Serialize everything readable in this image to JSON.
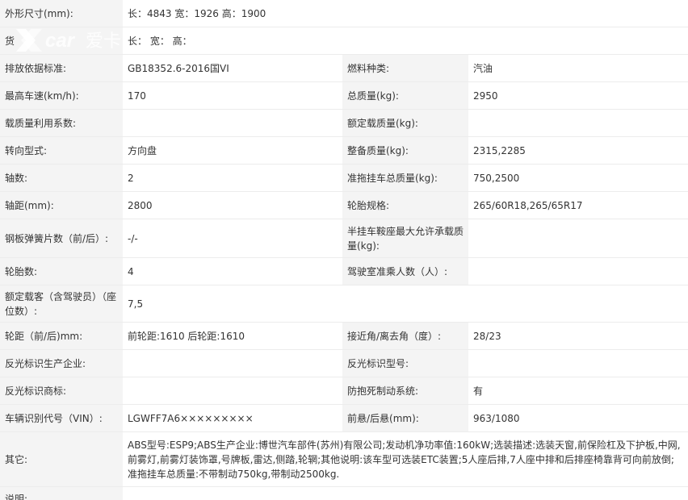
{
  "rows": [
    {
      "l1": "外形尺寸(mm):",
      "v1": "长：4843 宽：1926 高：1900",
      "l2": "",
      "v2": ""
    },
    {
      "l1": "货",
      "v1": "长：   宽：   高：",
      "l2": "",
      "v2": ""
    },
    {
      "l1": "排放依据标准:",
      "v1": "GB18352.6-2016国VI",
      "l2": "燃料种类:",
      "v2": "汽油"
    },
    {
      "l1": "最高车速(km/h):",
      "v1": "170",
      "l2": "总质量(kg):",
      "v2": "2950"
    },
    {
      "l1": "载质量利用系数:",
      "v1": "",
      "l2": "额定载质量(kg):",
      "v2": ""
    },
    {
      "l1": "转向型式:",
      "v1": "方向盘",
      "l2": "整备质量(kg):",
      "v2": "2315,2285"
    },
    {
      "l1": "轴数:",
      "v1": "2",
      "l2": "准拖挂车总质量(kg):",
      "v2": "750,2500"
    },
    {
      "l1": "轴距(mm):",
      "v1": "2800",
      "l2": "轮胎规格:",
      "v2": "265/60R18,265/65R17"
    },
    {
      "l1": "钢板弹簧片数（前/后）:",
      "v1": "-/-",
      "l2": "半挂车鞍座最大允许承载质量(kg):",
      "v2": ""
    },
    {
      "l1": "轮胎数:",
      "v1": "4",
      "l2": "驾驶室准乘人数（人）:",
      "v2": ""
    },
    {
      "l1": "额定载客（含驾驶员）（座位数）:",
      "v1": "7,5",
      "l2": "",
      "v2": ""
    },
    {
      "l1": "轮距（前/后)mm:",
      "v1": "前轮距:1610 后轮距:1610",
      "l2": "接近角/离去角（度）:",
      "v2": "28/23"
    },
    {
      "l1": "反光标识生产企业:",
      "v1": "",
      "l2": "反光标识型号:",
      "v2": ""
    },
    {
      "l1": "反光标识商标:",
      "v1": "",
      "l2": "防抱死制动系统:",
      "v2": "有"
    },
    {
      "l1": "车辆识别代号（VIN）:",
      "v1": "LGWFF7A6×××××××××",
      "l2": "前悬/后悬(mm):",
      "v2": "963/1080"
    },
    {
      "l1": "其它:",
      "v1": "ABS型号:ESP9;ABS生产企业:博世汽车部件(苏州)有限公司;发动机净功率值:160kW;选装描述:选装天窗,前保险杠及下护板,中网,前雾灯,前雾灯装饰罩,号牌板,雷达,侧踏,轮辋;其他说明:该车型可选装ETC装置;5人座后排,7人座中排和后排座椅靠背可向前放倒;准拖挂车总质量:不带制动750kg,带制动2500kg.",
      "l2": "",
      "v2": ""
    },
    {
      "l1": "说明:",
      "v1": "",
      "l2": "",
      "v2": ""
    }
  ],
  "watermark": {
    "brand": "爱卡",
    "color": "#ffffff"
  }
}
